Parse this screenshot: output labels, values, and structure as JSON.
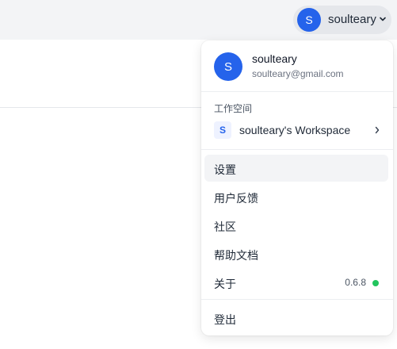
{
  "account_button": {
    "avatar_initial": "S",
    "username": "soulteary",
    "icon": "chevron-down-icon"
  },
  "menu": {
    "profile": {
      "avatar_initial": "S",
      "name": "soulteary",
      "email": "soulteary@gmail.com"
    },
    "workspace": {
      "section_label": "工作空间",
      "badge_initial": "S",
      "name": "soulteary's Workspace",
      "icon": "chevron-right-icon"
    },
    "items": [
      {
        "label": "设置"
      },
      {
        "label": "用户反馈"
      },
      {
        "label": "社区"
      },
      {
        "label": "帮助文档"
      },
      {
        "label": "关于"
      }
    ],
    "about_version": "0.6.8",
    "logout_label": "登出"
  },
  "colors": {
    "accent": "#2563eb",
    "status_ok": "#22c55e"
  }
}
